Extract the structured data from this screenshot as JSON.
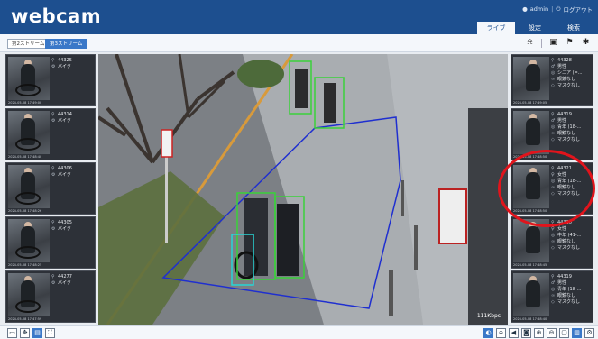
{
  "app": {
    "logo": "webcam"
  },
  "header": {
    "user": "admin",
    "logout": "ログアウト",
    "tabs": [
      {
        "label": "ライブ",
        "active": true
      },
      {
        "label": "設定",
        "active": false
      },
      {
        "label": "検索",
        "active": false
      }
    ]
  },
  "toolbar": {
    "streams": [
      {
        "label": "第2ストリーム",
        "active": false
      },
      {
        "label": "第3ストリーム",
        "active": true
      }
    ],
    "icons": [
      "alarm-icon",
      "layout-icon",
      "flag-icon",
      "person-run-icon"
    ]
  },
  "left_cards": [
    {
      "id": "44325",
      "type": "バイク",
      "time": "2024-05-08 17:49:00"
    },
    {
      "id": "44314",
      "type": "バイク",
      "time": "2024-05-08 17:48:40"
    },
    {
      "id": "44306",
      "type": "バイク",
      "time": "2024-05-08 17:48:26"
    },
    {
      "id": "44305",
      "type": "バイク",
      "time": "2024-05-08 17:48:25"
    },
    {
      "id": "44277",
      "type": "バイク",
      "time": "2024-05-08 17:47:59"
    }
  ],
  "right_cards": [
    {
      "id": "44328",
      "gender": "男性",
      "age": "シニア (=...",
      "glasses": "眼鏡なし",
      "mask": "マスクなし",
      "time": "2024-05-08 17:49:05"
    },
    {
      "id": "44319",
      "gender": "男性",
      "age": "青年 (18-...",
      "glasses": "眼鏡なし",
      "mask": "マスクなし",
      "time": "2024-05-08 17:48:50"
    },
    {
      "id": "44321",
      "gender": "女性",
      "age": "青年 (18-...",
      "glasses": "眼鏡なし",
      "mask": "マスクなし",
      "time": "2024-05-08 17:48:50"
    },
    {
      "id": "44320",
      "gender": "女性",
      "age": "中年 (41-...",
      "glasses": "眼鏡なし",
      "mask": "マスクなし",
      "time": "2024-05-08 17:48:45"
    },
    {
      "id": "44319",
      "gender": "男性",
      "age": "青年 (18-...",
      "glasses": "眼鏡なし",
      "mask": "マスクなし",
      "time": "2024-05-08 17:48:40"
    }
  ],
  "video": {
    "bitrate": "111Kbps"
  },
  "colors": {
    "brand": "#1d4f8f",
    "accent": "#3a78c8",
    "detect_box": "#3ad13a",
    "bike_box": "#27d6d6",
    "region": "#1f2fd0",
    "highlight": "#e1141c"
  }
}
